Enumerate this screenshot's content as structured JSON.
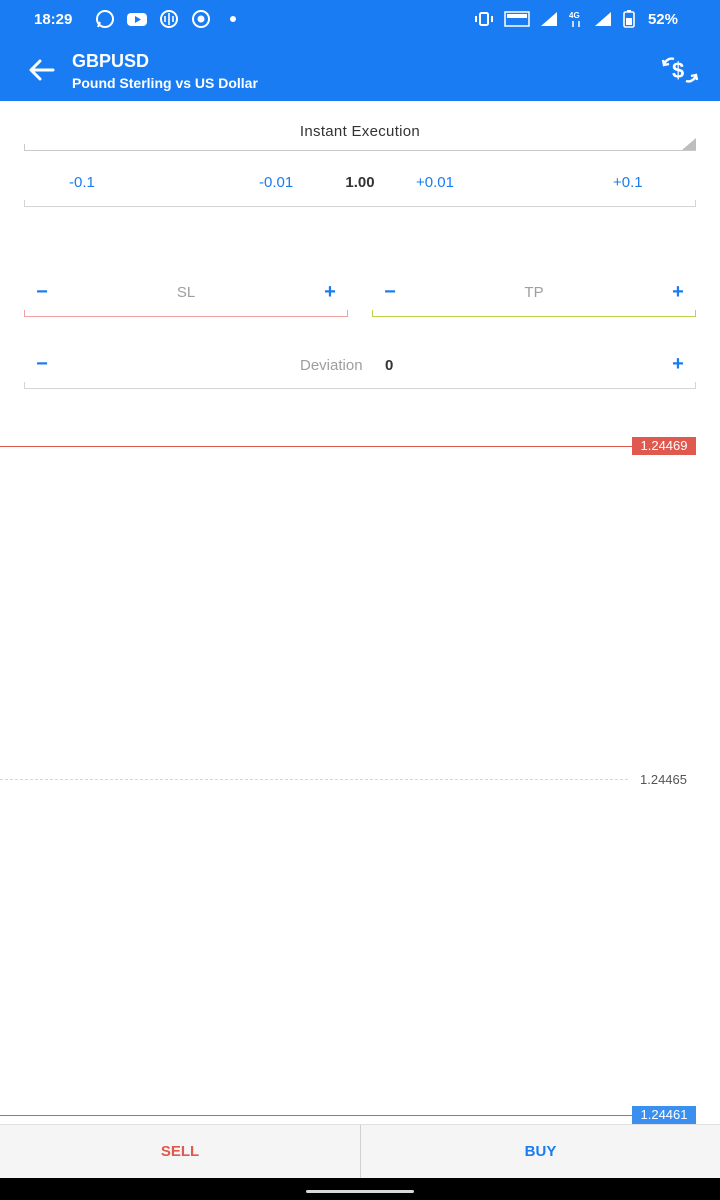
{
  "status_bar": {
    "time": "18:29",
    "battery": "52%",
    "left_icons": [
      "whatsapp-icon",
      "youtube-icon",
      "app-icon",
      "screen-record-icon",
      "dot-icon"
    ],
    "right_icons": [
      "vibrate-icon",
      "volte-icon",
      "signal-icon",
      "4g-icon",
      "signal-icon",
      "battery-icon"
    ]
  },
  "header": {
    "symbol": "GBPUSD",
    "description": "Pound Sterling vs US Dollar",
    "back_icon": "arrow-left-icon",
    "action_icon": "currency-exchange-icon"
  },
  "order": {
    "type": "Instant Execution",
    "volume": {
      "minus_large": "-0.1",
      "minus_small": "-0.01",
      "value": "1.00",
      "plus_small": "+0.01",
      "plus_large": "+0.1"
    },
    "sl": {
      "placeholder": "SL",
      "minus": "−",
      "plus": "+"
    },
    "tp": {
      "placeholder": "TP",
      "minus": "−",
      "plus": "+"
    },
    "deviation": {
      "label": "Deviation",
      "value": "0",
      "minus": "−",
      "plus": "+"
    }
  },
  "prices": {
    "ask": "1.24469",
    "mid": "1.24465",
    "bid": "1.24461"
  },
  "actions": {
    "sell": "SELL",
    "buy": "BUY"
  },
  "colors": {
    "primary": "#1a7cf2",
    "sell": "#e0594f",
    "buy": "#1a7cf2"
  }
}
